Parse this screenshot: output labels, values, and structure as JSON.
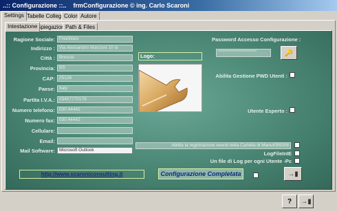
{
  "window": {
    "title": "..:: Configurazione ::..    frmConfigurazione © ing. Carlo Scaroni"
  },
  "outer_tabs": [
    "Settings",
    "Tabelle Collegate",
    "Colori",
    "Autore"
  ],
  "inner_tabs": [
    "Intestazione",
    "Spiegazioni",
    "Path & Files"
  ],
  "form": {
    "labels": [
      "Ragione Sociale:",
      "Indirizzo :",
      "Città :",
      "Provincia:",
      "CAP:",
      "Paese:",
      "Partita I.V.A.:",
      "Numero telefono:",
      "Numero fax:",
      "Cellulare:",
      "Email:",
      "Mail Software:"
    ],
    "values": [
      "FreeWare",
      "Via Alessandro Manzoni 10 la",
      "Brescia",
      "BS",
      "25126",
      "Italy",
      "03457770178",
      "030 44442",
      "030 44442",
      "",
      "",
      "Microsoft Outlook"
    ]
  },
  "logo_label": "Logo:",
  "password": {
    "label": "Password Accesso Configurazione :",
    "value": "************************"
  },
  "options": {
    "pwd_users": "Abilita Gestione PWD Utenti :",
    "expert_user": "Utente Esperto :",
    "log_events": "Abilita la registrazione eventi nella Cartella di  Manut099308",
    "logfile": "LogFileInIE",
    "log_per_user": "Un file di Log per ogni Utente -Pc"
  },
  "link": "http://www.scaroniconsulting.it",
  "status": "Configurazione Completata",
  "buttons": {
    "help": "?",
    "exit": "exit"
  }
}
